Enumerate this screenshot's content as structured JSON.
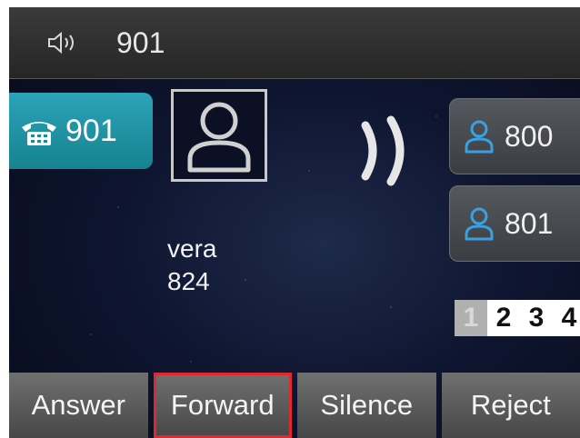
{
  "status_bar": {
    "icon": "speaker-icon",
    "number": "901"
  },
  "line_key": {
    "icon": "phone-icon",
    "number": "901",
    "color": "#1f93a3"
  },
  "caller": {
    "icon": "person-avatar-icon",
    "name": "vera",
    "number": "824"
  },
  "ringing": {
    "icon": "ringing-waves-icon"
  },
  "contact_keys": [
    {
      "icon": "person-icon",
      "number": "800"
    },
    {
      "icon": "person-icon",
      "number": "801"
    }
  ],
  "pager": {
    "pages": [
      "1",
      "2",
      "3",
      "4"
    ],
    "active": "1"
  },
  "softkeys": [
    {
      "label": "Answer"
    },
    {
      "label": "Forward",
      "highlighted": true
    },
    {
      "label": "Silence"
    },
    {
      "label": "Reject"
    }
  ],
  "colors": {
    "accent": "#2ba3b8",
    "contact_icon": "#3aa0e0",
    "highlight_border": "#e0282e"
  }
}
